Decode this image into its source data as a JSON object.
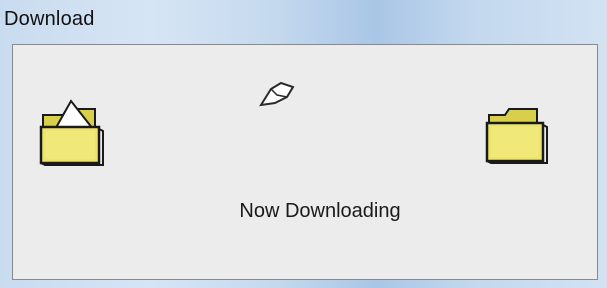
{
  "window": {
    "title": "Download"
  },
  "animation": {
    "source_folder_icon": "open-folder-icon",
    "target_folder_icon": "folder-icon",
    "moving_item_icon": "flying-document-icon"
  },
  "status": {
    "message": "Now Downloading"
  },
  "colors": {
    "folder_fill": "#e8e06a",
    "folder_shade": "#c9be3a",
    "client_bg": "#ececec",
    "title_bar": "#c5d9ee"
  }
}
